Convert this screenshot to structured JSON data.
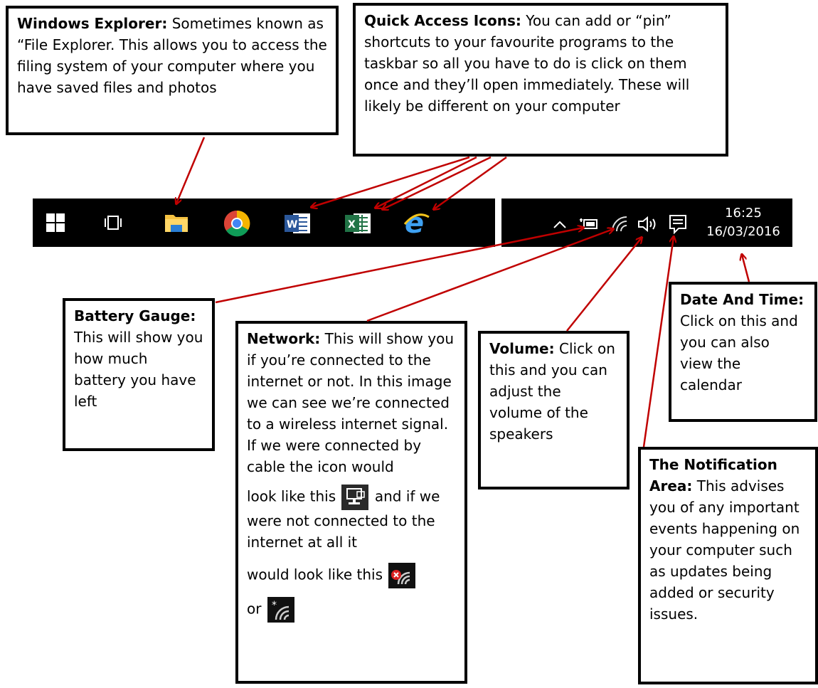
{
  "callouts": {
    "windows_explorer": {
      "title": "Windows Explorer:",
      "body": "Sometimes known as “File Explorer.  This allows you to access the filing system of your computer where you have saved files and photos"
    },
    "quick_access": {
      "title": "Quick Access Icons:",
      "body": "You can add or “pin” shortcuts to your favourite programs to the taskbar so all you have to do is click on them once and they’ll open immediately. These will likely be different on your computer"
    },
    "battery": {
      "title": "Battery Gauge:",
      "body": "This will show you how much battery you have left"
    },
    "network": {
      "title": "Network:",
      "body": "This will show you if you’re connected to the internet or not. In this image we can see we’re connected to a wireless internet signal. If we were connected by cable the icon would",
      "cable_prefix": "look like this",
      "cable_suffix": "and if we were not connected to the internet at all it",
      "disconnected_prefix": "would look like this",
      "or_text": "or"
    },
    "volume": {
      "title": "Volume:",
      "body": "Click on this and you can adjust the volume of the speakers"
    },
    "date_time": {
      "title": "Date And Time:",
      "body": "Click on this and you can also view the calendar"
    },
    "notification": {
      "title": "The Notification Area:",
      "body": "This advises you of any important events happening on your computer such as updates being added or security issues."
    }
  },
  "taskbar": {
    "time": "16:25",
    "date": "16/03/2016",
    "icons": [
      "windows-start-icon",
      "task-view-icon",
      "file-explorer-icon",
      "chrome-icon",
      "word-icon",
      "excel-icon",
      "internet-explorer-icon"
    ],
    "tray_icons": [
      "chevron-up-icon",
      "battery-icon",
      "wifi-icon",
      "volume-icon",
      "notification-icon"
    ]
  },
  "colors": {
    "arrow": "#c00000",
    "taskbar": "#000000",
    "word": "#2b579a",
    "excel": "#217346",
    "ie": "#1e90ff",
    "explorer": "#f5c242"
  }
}
